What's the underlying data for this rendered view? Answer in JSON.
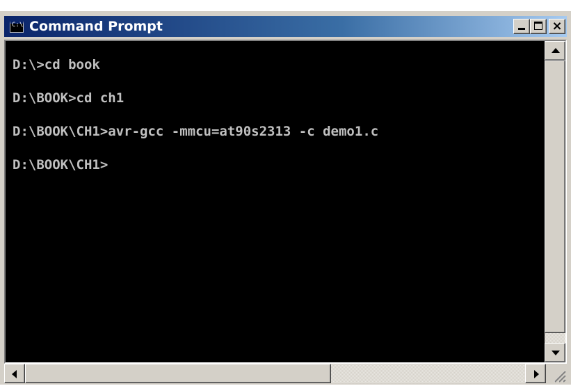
{
  "window": {
    "title": "Command Prompt",
    "icon": "console-app-icon",
    "icon_glyph": "C:\\"
  },
  "caption_buttons": {
    "minimize_icon": "minimize-icon",
    "maximize_icon": "maximize-icon",
    "close_icon": "close-icon",
    "close_glyph": "×"
  },
  "console": {
    "background": "#000000",
    "text_color": "#c0c0c0",
    "lines": [
      "D:\\>cd book",
      "D:\\BOOK>cd ch1",
      "D:\\BOOK\\CH1>avr-gcc -mmcu=at90s2313 -c demo1.c",
      "D:\\BOOK\\CH1>"
    ]
  },
  "colors": {
    "titlebar_start": "#0a246a",
    "titlebar_end": "#a6caf0",
    "chrome": "#d4d0c8"
  }
}
